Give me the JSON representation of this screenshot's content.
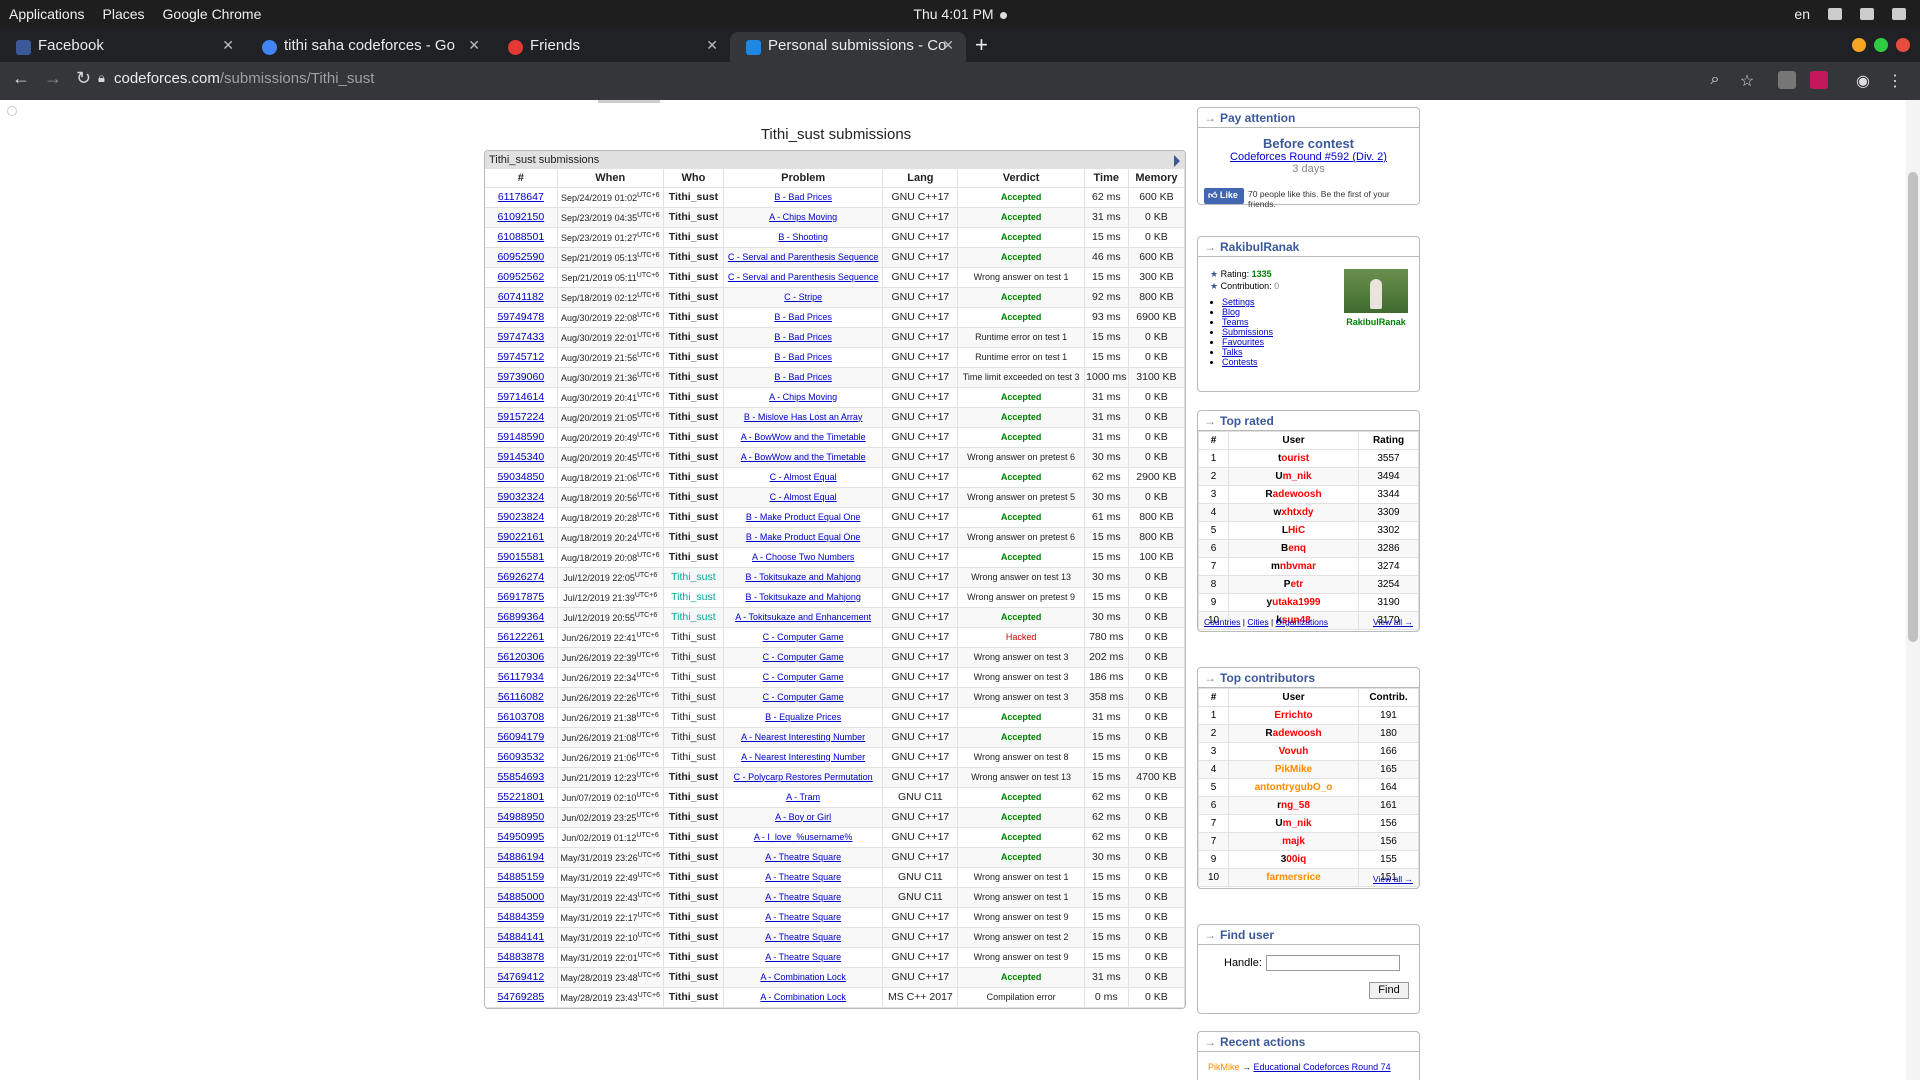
{
  "os": {
    "menus": [
      "Applications",
      "Places",
      "Google Chrome"
    ],
    "clock": "Thu 4:01 PM",
    "lang": "en"
  },
  "browser": {
    "tabs": [
      {
        "title": "Facebook",
        "favicon_color": "#3b5998"
      },
      {
        "title": "tithi saha codeforces - Go",
        "favicon_color": "#4285f4"
      },
      {
        "title": "Friends",
        "favicon_color": "#e53935"
      },
      {
        "title": "Personal submissions - Co",
        "favicon_color": "#1e88e5"
      }
    ],
    "url_host": "codeforces.com",
    "url_path": "/submissions/Tithi_sust"
  },
  "page": {
    "title": "Tithi_sust submissions",
    "table_caption": "Tithi_sust submissions",
    "columns": [
      "#",
      "When",
      "Who",
      "Problem",
      "Lang",
      "Verdict",
      "Time",
      "Memory"
    ],
    "rows": [
      {
        "id": "61178647",
        "when": "Sep/24/2019 01:02",
        "who": "Tithi_sust",
        "who_style": "green",
        "problem": "B - Bad Prices",
        "lang": "GNU C++17",
        "verdict": "Accepted",
        "vclass": "ok",
        "time": "62 ms",
        "mem": "600 KB"
      },
      {
        "id": "61092150",
        "when": "Sep/23/2019 04:35",
        "who": "Tithi_sust",
        "who_style": "green",
        "problem": "A - Chips Moving",
        "lang": "GNU C++17",
        "verdict": "Accepted",
        "vclass": "ok",
        "time": "31 ms",
        "mem": "0 KB"
      },
      {
        "id": "61088501",
        "when": "Sep/23/2019 01:27",
        "who": "Tithi_sust",
        "who_style": "green",
        "problem": "B - Shooting",
        "lang": "GNU C++17",
        "verdict": "Accepted",
        "vclass": "ok",
        "time": "15 ms",
        "mem": "0 KB"
      },
      {
        "id": "60952590",
        "when": "Sep/21/2019 05:13",
        "who": "Tithi_sust",
        "who_style": "green",
        "problem": "C - Serval and Parenthesis Sequence",
        "lang": "GNU C++17",
        "verdict": "Accepted",
        "vclass": "ok",
        "time": "46 ms",
        "mem": "600 KB"
      },
      {
        "id": "60952562",
        "when": "Sep/21/2019 05:11",
        "who": "Tithi_sust",
        "who_style": "green",
        "problem": "C - Serval and Parenthesis Sequence",
        "lang": "GNU C++17",
        "verdict": "Wrong answer on test 1",
        "vclass": "wa",
        "time": "15 ms",
        "mem": "300 KB"
      },
      {
        "id": "60741182",
        "when": "Sep/18/2019 02:12",
        "who": "Tithi_sust",
        "who_style": "green",
        "problem": "C - Stripe",
        "lang": "GNU C++17",
        "verdict": "Accepted",
        "vclass": "ok",
        "time": "92 ms",
        "mem": "800 KB"
      },
      {
        "id": "59749478",
        "when": "Aug/30/2019 22:08",
        "who": "Tithi_sust",
        "who_style": "green",
        "problem": "B - Bad Prices",
        "lang": "GNU C++17",
        "verdict": "Accepted",
        "vclass": "ok",
        "time": "93 ms",
        "mem": "6900 KB"
      },
      {
        "id": "59747433",
        "when": "Aug/30/2019 22:01",
        "who": "Tithi_sust",
        "who_style": "green",
        "problem": "B - Bad Prices",
        "lang": "GNU C++17",
        "verdict": "Runtime error on test 1",
        "vclass": "wa",
        "time": "15 ms",
        "mem": "0 KB"
      },
      {
        "id": "59745712",
        "when": "Aug/30/2019 21:56",
        "who": "Tithi_sust",
        "who_style": "green",
        "problem": "B - Bad Prices",
        "lang": "GNU C++17",
        "verdict": "Runtime error on test 1",
        "vclass": "wa",
        "time": "15 ms",
        "mem": "0 KB"
      },
      {
        "id": "59739060",
        "when": "Aug/30/2019 21:36",
        "who": "Tithi_sust",
        "who_style": "green",
        "problem": "B - Bad Prices",
        "lang": "GNU C++17",
        "verdict": "Time limit exceeded on test 3",
        "vclass": "wa",
        "time": "1000 ms",
        "mem": "3100 KB"
      },
      {
        "id": "59714614",
        "when": "Aug/30/2019 20:41",
        "who": "Tithi_sust",
        "who_style": "green",
        "problem": "A - Chips Moving",
        "lang": "GNU C++17",
        "verdict": "Accepted",
        "vclass": "ok",
        "time": "31 ms",
        "mem": "0 KB"
      },
      {
        "id": "59157224",
        "when": "Aug/20/2019 21:05",
        "who": "Tithi_sust",
        "who_style": "green",
        "problem": "B - Mislove Has Lost an Array",
        "lang": "GNU C++17",
        "verdict": "Accepted",
        "vclass": "ok",
        "time": "31 ms",
        "mem": "0 KB"
      },
      {
        "id": "59148590",
        "when": "Aug/20/2019 20:49",
        "who": "Tithi_sust",
        "who_style": "green",
        "problem": "A - BowWow and the Timetable",
        "lang": "GNU C++17",
        "verdict": "Accepted",
        "vclass": "ok",
        "time": "31 ms",
        "mem": "0 KB"
      },
      {
        "id": "59145340",
        "when": "Aug/20/2019 20:45",
        "who": "Tithi_sust",
        "who_style": "green",
        "problem": "A - BowWow and the Timetable",
        "lang": "GNU C++17",
        "verdict": "Wrong answer on pretest 6",
        "vclass": "wa",
        "time": "30 ms",
        "mem": "0 KB"
      },
      {
        "id": "59034850",
        "when": "Aug/18/2019 21:06",
        "who": "Tithi_sust",
        "who_style": "green",
        "problem": "C - Almost Equal",
        "lang": "GNU C++17",
        "verdict": "Accepted",
        "vclass": "ok",
        "time": "62 ms",
        "mem": "2900 KB"
      },
      {
        "id": "59032324",
        "when": "Aug/18/2019 20:56",
        "who": "Tithi_sust",
        "who_style": "green",
        "problem": "C - Almost Equal",
        "lang": "GNU C++17",
        "verdict": "Wrong answer on pretest 5",
        "vclass": "wa",
        "time": "30 ms",
        "mem": "0 KB"
      },
      {
        "id": "59023824",
        "when": "Aug/18/2019 20:28",
        "who": "Tithi_sust",
        "who_style": "green",
        "problem": "B - Make Product Equal One",
        "lang": "GNU C++17",
        "verdict": "Accepted",
        "vclass": "ok",
        "time": "61 ms",
        "mem": "800 KB"
      },
      {
        "id": "59022161",
        "when": "Aug/18/2019 20:24",
        "who": "Tithi_sust",
        "who_style": "green",
        "problem": "B - Make Product Equal One",
        "lang": "GNU C++17",
        "verdict": "Wrong answer on pretest 6",
        "vclass": "wa",
        "time": "15 ms",
        "mem": "800 KB"
      },
      {
        "id": "59015581",
        "when": "Aug/18/2019 20:08",
        "who": "Tithi_sust",
        "who_style": "green",
        "problem": "A - Choose Two Numbers",
        "lang": "GNU C++17",
        "verdict": "Accepted",
        "vclass": "ok",
        "time": "15 ms",
        "mem": "100 KB"
      },
      {
        "id": "56926274",
        "when": "Jul/12/2019 22:05",
        "who": "Tithi_sust",
        "who_style": "cyan",
        "problem": "B - Tokitsukaze and Mahjong",
        "lang": "GNU C++17",
        "verdict": "Wrong answer on test 13",
        "vclass": "wa",
        "time": "30 ms",
        "mem": "0 KB"
      },
      {
        "id": "56917875",
        "when": "Jul/12/2019 21:39",
        "who": "Tithi_sust",
        "who_style": "cyan",
        "problem": "B - Tokitsukaze and Mahjong",
        "lang": "GNU C++17",
        "verdict": "Wrong answer on pretest 9",
        "vclass": "wa",
        "time": "15 ms",
        "mem": "0 KB"
      },
      {
        "id": "56899364",
        "when": "Jul/12/2019 20:55",
        "who": "Tithi_sust",
        "who_style": "cyan",
        "problem": "A - Tokitsukaze and Enhancement",
        "lang": "GNU C++17",
        "verdict": "Accepted",
        "vclass": "ok",
        "time": "30 ms",
        "mem": "0 KB"
      },
      {
        "id": "56122261",
        "when": "Jun/26/2019 22:41",
        "who": "Tithi_sust",
        "who_style": "gray",
        "problem": "C - Computer Game",
        "lang": "GNU C++17",
        "verdict": "Hacked",
        "vclass": "hack",
        "time": "780 ms",
        "mem": "0 KB"
      },
      {
        "id": "56120306",
        "when": "Jun/26/2019 22:39",
        "who": "Tithi_sust",
        "who_style": "gray",
        "problem": "C - Computer Game",
        "lang": "GNU C++17",
        "verdict": "Wrong answer on test 3",
        "vclass": "wa",
        "time": "202 ms",
        "mem": "0 KB"
      },
      {
        "id": "56117934",
        "when": "Jun/26/2019 22:34",
        "who": "Tithi_sust",
        "who_style": "gray",
        "problem": "C - Computer Game",
        "lang": "GNU C++17",
        "verdict": "Wrong answer on test 3",
        "vclass": "wa",
        "time": "186 ms",
        "mem": "0 KB"
      },
      {
        "id": "56116082",
        "when": "Jun/26/2019 22:26",
        "who": "Tithi_sust",
        "who_style": "gray",
        "problem": "C - Computer Game",
        "lang": "GNU C++17",
        "verdict": "Wrong answer on test 3",
        "vclass": "wa",
        "time": "358 ms",
        "mem": "0 KB"
      },
      {
        "id": "56103708",
        "when": "Jun/26/2019 21:38",
        "who": "Tithi_sust",
        "who_style": "gray",
        "problem": "B - Equalize Prices",
        "lang": "GNU C++17",
        "verdict": "Accepted",
        "vclass": "ok",
        "time": "31 ms",
        "mem": "0 KB"
      },
      {
        "id": "56094179",
        "when": "Jun/26/2019 21:08",
        "who": "Tithi_sust",
        "who_style": "gray",
        "problem": "A - Nearest Interesting Number",
        "lang": "GNU C++17",
        "verdict": "Accepted",
        "vclass": "ok",
        "time": "15 ms",
        "mem": "0 KB"
      },
      {
        "id": "56093532",
        "when": "Jun/26/2019 21:06",
        "who": "Tithi_sust",
        "who_style": "gray",
        "problem": "A - Nearest Interesting Number",
        "lang": "GNU C++17",
        "verdict": "Wrong answer on test 8",
        "vclass": "wa",
        "time": "15 ms",
        "mem": "0 KB"
      },
      {
        "id": "55854693",
        "when": "Jun/21/2019 12:23",
        "who": "Tithi_sust",
        "who_style": "green",
        "problem": "C - Polycarp Restores Permutation",
        "lang": "GNU C++17",
        "verdict": "Wrong answer on test 13",
        "vclass": "wa",
        "time": "15 ms",
        "mem": "4700 KB"
      },
      {
        "id": "55221801",
        "when": "Jun/07/2019 02:10",
        "who": "Tithi_sust",
        "who_style": "green",
        "problem": "A - Tram",
        "lang": "GNU C11",
        "verdict": "Accepted",
        "vclass": "ok",
        "time": "62 ms",
        "mem": "0 KB"
      },
      {
        "id": "54988950",
        "when": "Jun/02/2019 23:25",
        "who": "Tithi_sust",
        "who_style": "green",
        "problem": "A - Boy or Girl",
        "lang": "GNU C++17",
        "verdict": "Accepted",
        "vclass": "ok",
        "time": "62 ms",
        "mem": "0 KB"
      },
      {
        "id": "54950995",
        "when": "Jun/02/2019 01:12",
        "who": "Tithi_sust",
        "who_style": "green",
        "problem": "A - I_love_%username%",
        "lang": "GNU C++17",
        "verdict": "Accepted",
        "vclass": "ok",
        "time": "62 ms",
        "mem": "0 KB"
      },
      {
        "id": "54886194",
        "when": "May/31/2019 23:26",
        "who": "Tithi_sust",
        "who_style": "green",
        "problem": "A - Theatre Square",
        "lang": "GNU C++17",
        "verdict": "Accepted",
        "vclass": "ok",
        "time": "30 ms",
        "mem": "0 KB"
      },
      {
        "id": "54885159",
        "when": "May/31/2019 22:49",
        "who": "Tithi_sust",
        "who_style": "green",
        "problem": "A - Theatre Square",
        "lang": "GNU C11",
        "verdict": "Wrong answer on test 1",
        "vclass": "wa",
        "time": "15 ms",
        "mem": "0 KB"
      },
      {
        "id": "54885000",
        "when": "May/31/2019 22:43",
        "who": "Tithi_sust",
        "who_style": "green",
        "problem": "A - Theatre Square",
        "lang": "GNU C11",
        "verdict": "Wrong answer on test 1",
        "vclass": "wa",
        "time": "15 ms",
        "mem": "0 KB"
      },
      {
        "id": "54884359",
        "when": "May/31/2019 22:17",
        "who": "Tithi_sust",
        "who_style": "green",
        "problem": "A - Theatre Square",
        "lang": "GNU C++17",
        "verdict": "Wrong answer on test 9",
        "vclass": "wa",
        "time": "15 ms",
        "mem": "0 KB"
      },
      {
        "id": "54884141",
        "when": "May/31/2019 22:10",
        "who": "Tithi_sust",
        "who_style": "green",
        "problem": "A - Theatre Square",
        "lang": "GNU C++17",
        "verdict": "Wrong answer on test 2",
        "vclass": "wa",
        "time": "15 ms",
        "mem": "0 KB"
      },
      {
        "id": "54883878",
        "when": "May/31/2019 22:01",
        "who": "Tithi_sust",
        "who_style": "green",
        "problem": "A - Theatre Square",
        "lang": "GNU C++17",
        "verdict": "Wrong answer on test 9",
        "vclass": "wa",
        "time": "15 ms",
        "mem": "0 KB"
      },
      {
        "id": "54769412",
        "when": "May/28/2019 23:48",
        "who": "Tithi_sust",
        "who_style": "green",
        "problem": "A - Combination Lock",
        "lang": "GNU C++17",
        "verdict": "Accepted",
        "vclass": "ok",
        "time": "31 ms",
        "mem": "0 KB"
      },
      {
        "id": "54769285",
        "when": "May/28/2019 23:43",
        "who": "Tithi_sust",
        "who_style": "green",
        "problem": "A - Combination Lock",
        "lang": "MS C++ 2017",
        "verdict": "Compilation error",
        "vclass": "ce",
        "time": "0 ms",
        "mem": "0 KB"
      }
    ],
    "utc_label": "UTC+6"
  },
  "sidebar": {
    "pay_attention": {
      "title": "Pay attention",
      "before": "Before contest",
      "contest": "Codeforces Round #592 (Div. 2)",
      "days": "3 days",
      "like_btn": "Like",
      "like_text": "70 people like this. Be the first of your friends."
    },
    "profile": {
      "title": "RakibulRanak",
      "rating_label": "Rating:",
      "rating": "1335",
      "contrib_label": "Contribution:",
      "contrib": "0",
      "links": [
        "Settings",
        "Blog",
        "Teams",
        "Submissions",
        "Favourites",
        "Talks",
        "Contests"
      ],
      "avatar_name": "RakibulRanak"
    },
    "top_rated": {
      "title": "Top rated",
      "headers": [
        "#",
        "User",
        "Rating"
      ],
      "rows": [
        {
          "rank": "1",
          "first": "t",
          "rest": "ourist",
          "value": "3557"
        },
        {
          "rank": "2",
          "first": "U",
          "rest": "m_nik",
          "value": "3494"
        },
        {
          "rank": "3",
          "first": "R",
          "rest": "adewoosh",
          "value": "3344"
        },
        {
          "rank": "4",
          "first": "w",
          "rest": "xhtxdy",
          "value": "3309"
        },
        {
          "rank": "5",
          "first": "L",
          "rest": "HiC",
          "value": "3302"
        },
        {
          "rank": "6",
          "first": "B",
          "rest": "enq",
          "value": "3286"
        },
        {
          "rank": "7",
          "first": "m",
          "rest": "nbvmar",
          "value": "3274"
        },
        {
          "rank": "8",
          "first": "P",
          "rest": "etr",
          "value": "3254"
        },
        {
          "rank": "9",
          "first": "y",
          "rest": "utaka1999",
          "value": "3190"
        },
        {
          "rank": "10",
          "first": "k",
          "rest": "sun48",
          "value": "3170"
        }
      ],
      "footer_links": [
        "Countries",
        "Cities",
        "Organizations"
      ],
      "view_all": "View all →"
    },
    "top_contributors": {
      "title": "Top contributors",
      "headers": [
        "#",
        "User",
        "Contrib."
      ],
      "rows": [
        {
          "rank": "1",
          "first": "",
          "rest": "Errichto",
          "value": "191",
          "color": "red"
        },
        {
          "rank": "2",
          "first": "R",
          "rest": "adewoosh",
          "value": "180",
          "color": "legend"
        },
        {
          "rank": "3",
          "first": "",
          "rest": "Vovuh",
          "value": "166",
          "color": "red"
        },
        {
          "rank": "4",
          "first": "",
          "rest": "PikMike",
          "value": "165",
          "color": "orange"
        },
        {
          "rank": "5",
          "first": "",
          "rest": "antontrygubO_o",
          "value": "164",
          "color": "orange"
        },
        {
          "rank": "6",
          "first": "r",
          "rest": "ng_58",
          "value": "161",
          "color": "legend"
        },
        {
          "rank": "7",
          "first": "U",
          "rest": "m_nik",
          "value": "156",
          "color": "legend"
        },
        {
          "rank": "7",
          "first": "",
          "rest": "majk",
          "value": "156",
          "color": "red"
        },
        {
          "rank": "9",
          "first": "3",
          "rest": "00iq",
          "value": "155",
          "color": "legend"
        },
        {
          "rank": "10",
          "first": "",
          "rest": "farmersrice",
          "value": "151",
          "color": "orange"
        }
      ],
      "view_all": "View all →"
    },
    "find_user": {
      "title": "Find user",
      "handle_label": "Handle:",
      "button": "Find"
    },
    "recent": {
      "title": "Recent actions",
      "user": "PikMike",
      "link": "Educational Codeforces Round 74"
    }
  }
}
